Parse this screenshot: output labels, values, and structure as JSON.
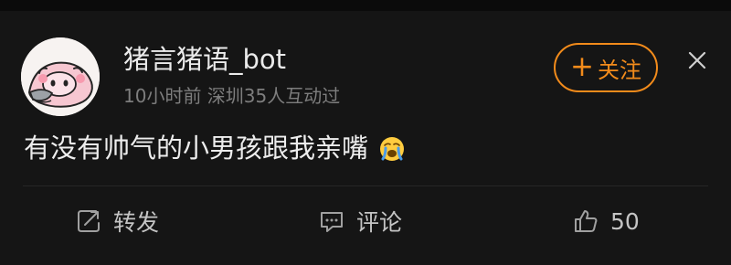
{
  "post": {
    "username": "猪言猪语_bot",
    "meta": "10小时前 深圳35人互动过",
    "follow_label": "关注",
    "text": "有没有帅气的小男孩跟我亲嘴"
  },
  "actions": {
    "repost_label": "转发",
    "comment_label": "评论",
    "like_count": "50"
  },
  "colors": {
    "accent": "#f28b1b",
    "background": "#151515",
    "text": "#ededed",
    "muted": "#7d7d7d"
  },
  "icons": {
    "avatar": "cartoon-pig-avatar",
    "follow_plus": "plus-icon",
    "close": "close-icon",
    "emoji": "crying-emoji-icon",
    "repost": "repost-icon",
    "comment": "comment-icon",
    "like": "thumbs-up-icon"
  }
}
